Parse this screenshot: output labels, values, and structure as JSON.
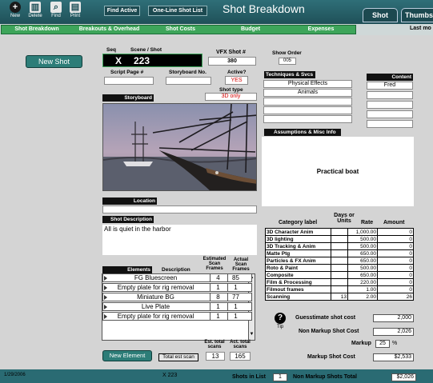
{
  "toolbar": {
    "new": "New",
    "delete": "Delete",
    "find": "Find",
    "print": "Print",
    "find_active": "Find Active",
    "one_line": "One-Line Shot List",
    "title": "Shot Breakdown",
    "tab_shot": "Shot",
    "tab_thumbs": "Thumbs"
  },
  "nav": {
    "items": [
      "Shot Breakdown",
      "Breakouts & Overhead",
      "Shot Costs",
      "Budget",
      "Expenses"
    ],
    "last_mod": "Last mo"
  },
  "left": {
    "new_shot": "New Shot"
  },
  "shot": {
    "seq_label": "Seq",
    "scene_label": "Scene / Shot",
    "seq": "X",
    "scene": "223",
    "vfx_label": "VFX Shot #",
    "vfx": "380",
    "show_order_label": "Show Order",
    "show_order": "005",
    "script_label": "Script Page #",
    "script": "",
    "storyboard_label": "Storyboard No.",
    "storyboard": "",
    "active_label": "Active?",
    "active": "YES",
    "shot_type_label": "Shot type",
    "shot_type": "3D only",
    "storyboard_header": "Storyboard",
    "location_label": "Location",
    "location": "",
    "desc_label": "Shot Description",
    "desc": "All is quiet in the harbor"
  },
  "techniques": {
    "header": "Techniques & Svcs",
    "items": [
      "Physical Effects",
      "Animals",
      "",
      "",
      ""
    ]
  },
  "content": {
    "header": "Content",
    "items": [
      "Fred",
      "",
      "",
      "",
      ""
    ]
  },
  "assumptions": {
    "header": "Assumptions & Misc Info",
    "text": "Practical boat"
  },
  "elements": {
    "header": "Elements",
    "desc_col": "Description",
    "est_col": "Estimated Scan Frames",
    "act_col": "Actual Scan Frames",
    "rows": [
      {
        "desc": "FG Bluescreen",
        "est": "4",
        "act": "85"
      },
      {
        "desc": "Empty plate for rig removal",
        "est": "1",
        "act": "1"
      },
      {
        "desc": "Miniature BG",
        "est": "8",
        "act": "77"
      },
      {
        "desc": "Live Plate",
        "est": "1",
        "act": "1"
      },
      {
        "desc": "Empty plate for rig removal",
        "est": "1",
        "act": "1"
      }
    ],
    "new_element": "New Element",
    "total_label": "Total est scan",
    "est_total_label": "Est. total scans",
    "act_total_label": "Act. total scans",
    "est_total": "13",
    "act_total": "165"
  },
  "costs": {
    "h_category": "Category label",
    "h_days": "Days or Units",
    "h_rate": "Rate",
    "h_amount": "Amount",
    "rows": [
      {
        "cat": "3D Character Anim",
        "days": "",
        "rate": "1,000.00",
        "amt": "0"
      },
      {
        "cat": "3D lighting",
        "days": "",
        "rate": "500.00",
        "amt": "0"
      },
      {
        "cat": "3D Tracking & Anim",
        "days": "",
        "rate": "500.00",
        "amt": "0"
      },
      {
        "cat": "Matte Ptg",
        "days": "",
        "rate": "650.00",
        "amt": "0"
      },
      {
        "cat": "Particles & FX Anim",
        "days": "",
        "rate": "650.00",
        "amt": "0"
      },
      {
        "cat": "Roto & Paint",
        "days": "",
        "rate": "500.00",
        "amt": "0"
      },
      {
        "cat": "Composite",
        "days": "",
        "rate": "650.00",
        "amt": "0"
      },
      {
        "cat": "Film & Processing",
        "days": "",
        "rate": "220.00",
        "amt": "0"
      },
      {
        "cat": "Filmout frames",
        "days": "",
        "rate": "1.00",
        "amt": "0"
      },
      {
        "cat": "Scanning",
        "days": "13",
        "rate": "2.00",
        "amt": "26"
      }
    ],
    "tip": "Tip",
    "guesstimate_label": "Guesstimate shot cost",
    "guesstimate": "2,000",
    "nonmarkup_label": "Non Markup Shot Cost",
    "nonmarkup": "2,026",
    "markup_label": "Markup",
    "markup": "25",
    "pct": "%",
    "markup_cost_label": "Markup Shot Cost",
    "markup_cost": "$2,533"
  },
  "footer": {
    "date": "1/29/2006",
    "shot": "X 223",
    "shots_label": "Shots in List",
    "shots": "1",
    "total_label": "Non Markup Shots Total",
    "total": "$2,026"
  },
  "colors": {
    "header_teal": "#2f6f78",
    "nav_green": "#3da55a",
    "red_text": "#d40000"
  }
}
